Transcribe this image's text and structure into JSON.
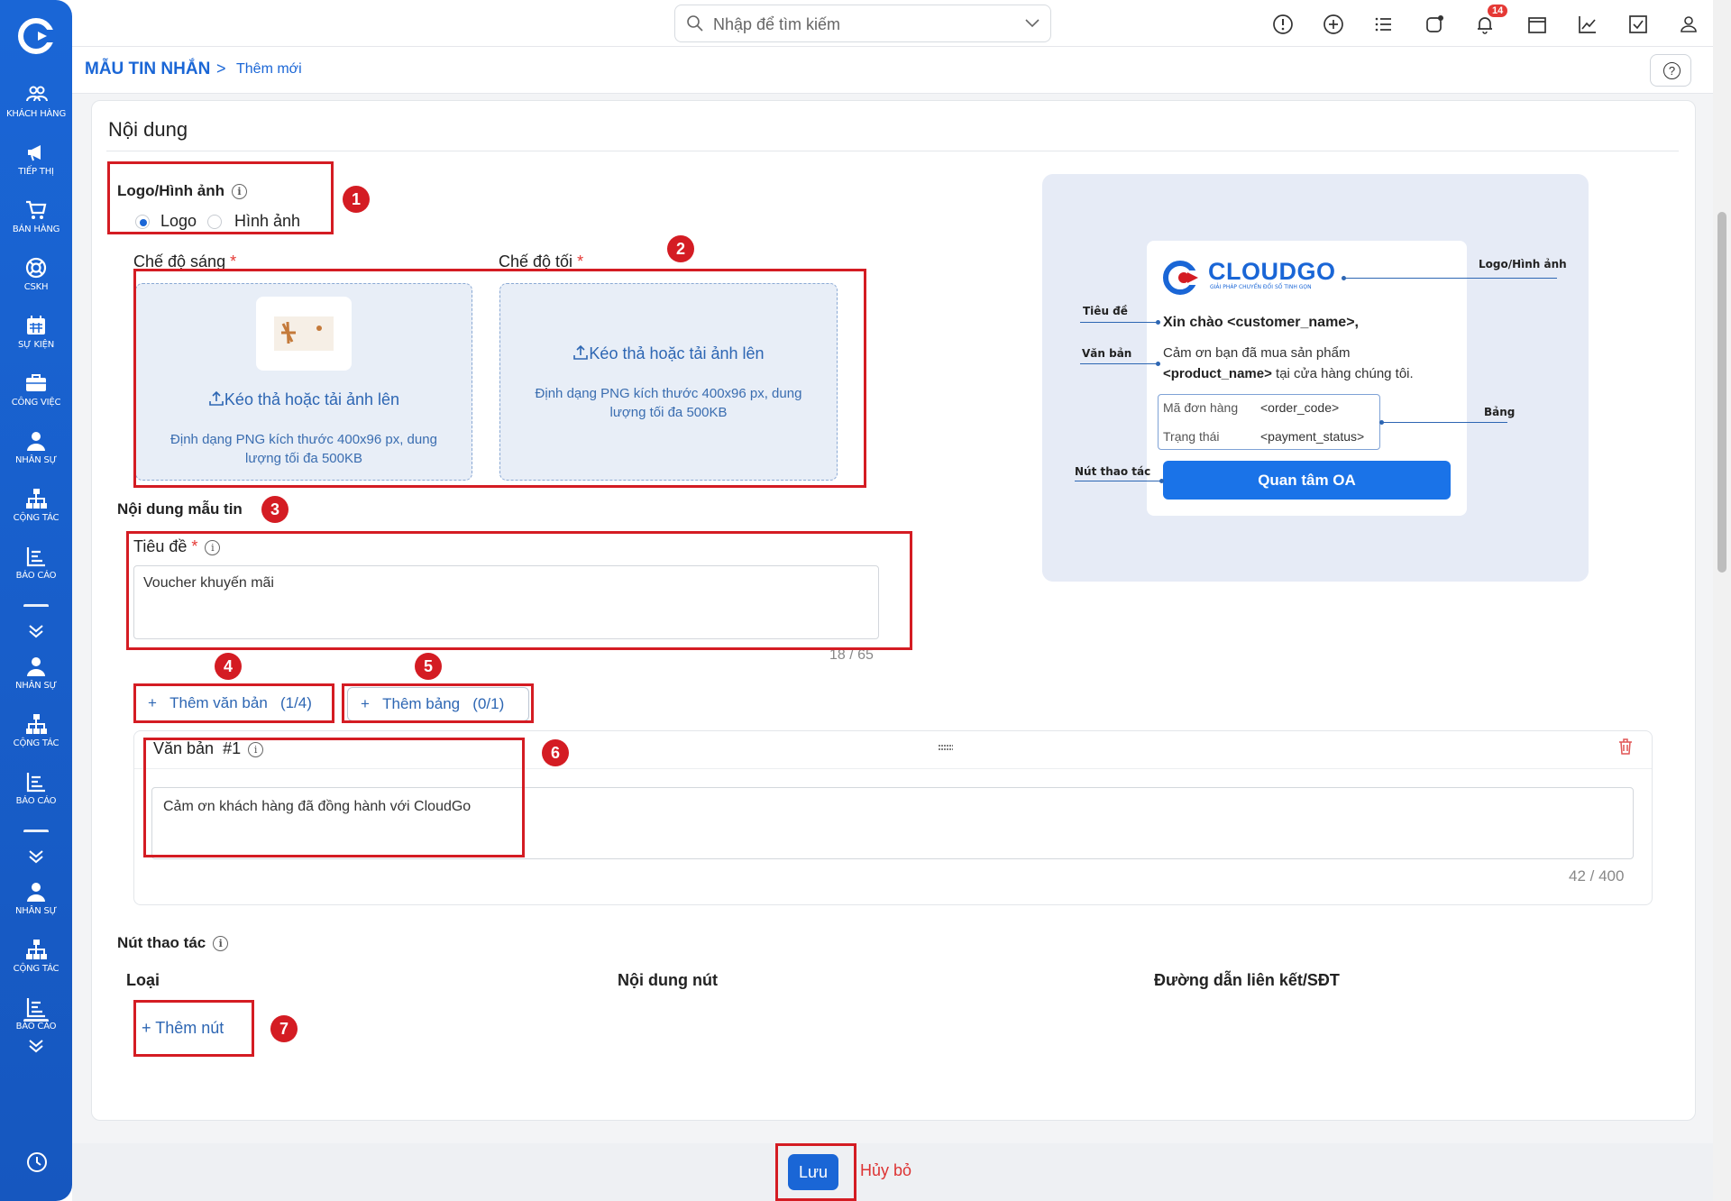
{
  "sidebar": {
    "items": [
      {
        "label": "KHÁCH HÀNG",
        "icon": "users-icon"
      },
      {
        "label": "TIẾP THỊ",
        "icon": "megaphone-icon"
      },
      {
        "label": "BÁN HÀNG",
        "icon": "cart-icon"
      },
      {
        "label": "CSKH",
        "icon": "lifebuoy-icon"
      },
      {
        "label": "SỰ KIỆN",
        "icon": "calendar-icon"
      },
      {
        "label": "CÔNG VIỆC",
        "icon": "briefcase-icon"
      },
      {
        "label": "NHÂN SỰ",
        "icon": "person-icon"
      },
      {
        "label": "CỘNG TÁC",
        "icon": "org-chart-icon"
      },
      {
        "label": "BÁO CÁO",
        "icon": "report-icon"
      },
      {
        "label": "NHÂN SỰ",
        "icon": "person-icon"
      },
      {
        "label": "CỘNG TÁC",
        "icon": "org-chart-icon"
      },
      {
        "label": "BÁO CÁO",
        "icon": "report-icon"
      },
      {
        "label": "NHÂN SỰ",
        "icon": "person-icon"
      },
      {
        "label": "CỘNG TÁC",
        "icon": "org-chart-icon"
      },
      {
        "label": "BÁO CÁO",
        "icon": "report-icon"
      }
    ]
  },
  "search": {
    "placeholder": "Nhập để tìm kiếm"
  },
  "notifications": {
    "count": "14"
  },
  "breadcrumb": {
    "main": "MẪU TIN NHẮN",
    "separator": ">",
    "current": "Thêm mới"
  },
  "form": {
    "section_title": "Nội dung",
    "logo_image": {
      "label": "Logo/Hình ảnh",
      "options": [
        "Logo",
        "Hình ảnh"
      ],
      "selected": "Logo"
    },
    "light_mode": {
      "label": "Chế độ sáng",
      "required": "*",
      "upload_text": "Kéo thả hoặc tải ảnh lên",
      "hint": "Định dạng PNG kích thước 400x96 px, dung lượng tối đa 500KB"
    },
    "dark_mode": {
      "label": "Chế độ tối",
      "required": "*",
      "upload_text": "Kéo thả hoặc tải ảnh lên",
      "hint": "Định dạng PNG kích thước 400x96 px, dung lượng tối đa 500KB"
    },
    "message_content_label": "Nội dung mẫu tin",
    "title_field": {
      "label": "Tiêu đề",
      "required": "*",
      "value": "Voucher khuyến mãi",
      "counter": "18 / 65"
    },
    "add_text_button": "Thêm văn bản",
    "add_text_count": "(1/4)",
    "add_table_button": "Thêm bảng",
    "add_table_count": "(0/1)",
    "text_block": {
      "label": "Văn bản",
      "index": "#1",
      "value": "Cảm ơn khách hàng đã đồng hành với CloudGo",
      "counter": "42 / 400"
    },
    "action_buttons": {
      "label": "Nút thao tác",
      "columns": [
        "Loại",
        "Nội dung nút",
        "Đường dẫn liên kết/SĐT"
      ],
      "add_button": "Thêm nút"
    }
  },
  "annotations": [
    "1",
    "2",
    "3",
    "4",
    "5",
    "6",
    "7"
  ],
  "preview": {
    "brand": "CLOUDGO",
    "tagline": "GIẢI PHÁP CHUYỂN ĐỔI SỐ TINH GỌN",
    "greeting": "Xin chào <customer_name>,",
    "body_line1": "Cảm ơn bạn đã mua sản phẩm",
    "body_product": "<product_name>",
    "body_line2": " tại cửa hàng chúng tôi.",
    "table_rows": [
      {
        "key": "Mã đơn hàng",
        "value": "<order_code>"
      },
      {
        "key": "Trạng thái",
        "value": "<payment_status>"
      }
    ],
    "button": "Quan tâm OA",
    "callouts": {
      "logo": "Logo/Hình ảnh",
      "title": "Tiêu đề",
      "text": "Văn bản",
      "table": "Bảng",
      "action": "Nút thao tác"
    }
  },
  "footer": {
    "save": "Lưu",
    "cancel": "Hủy bỏ"
  },
  "colors": {
    "primary": "#1a66d6",
    "annotation_red": "#d41c23",
    "cancel_red": "#dd3333"
  }
}
